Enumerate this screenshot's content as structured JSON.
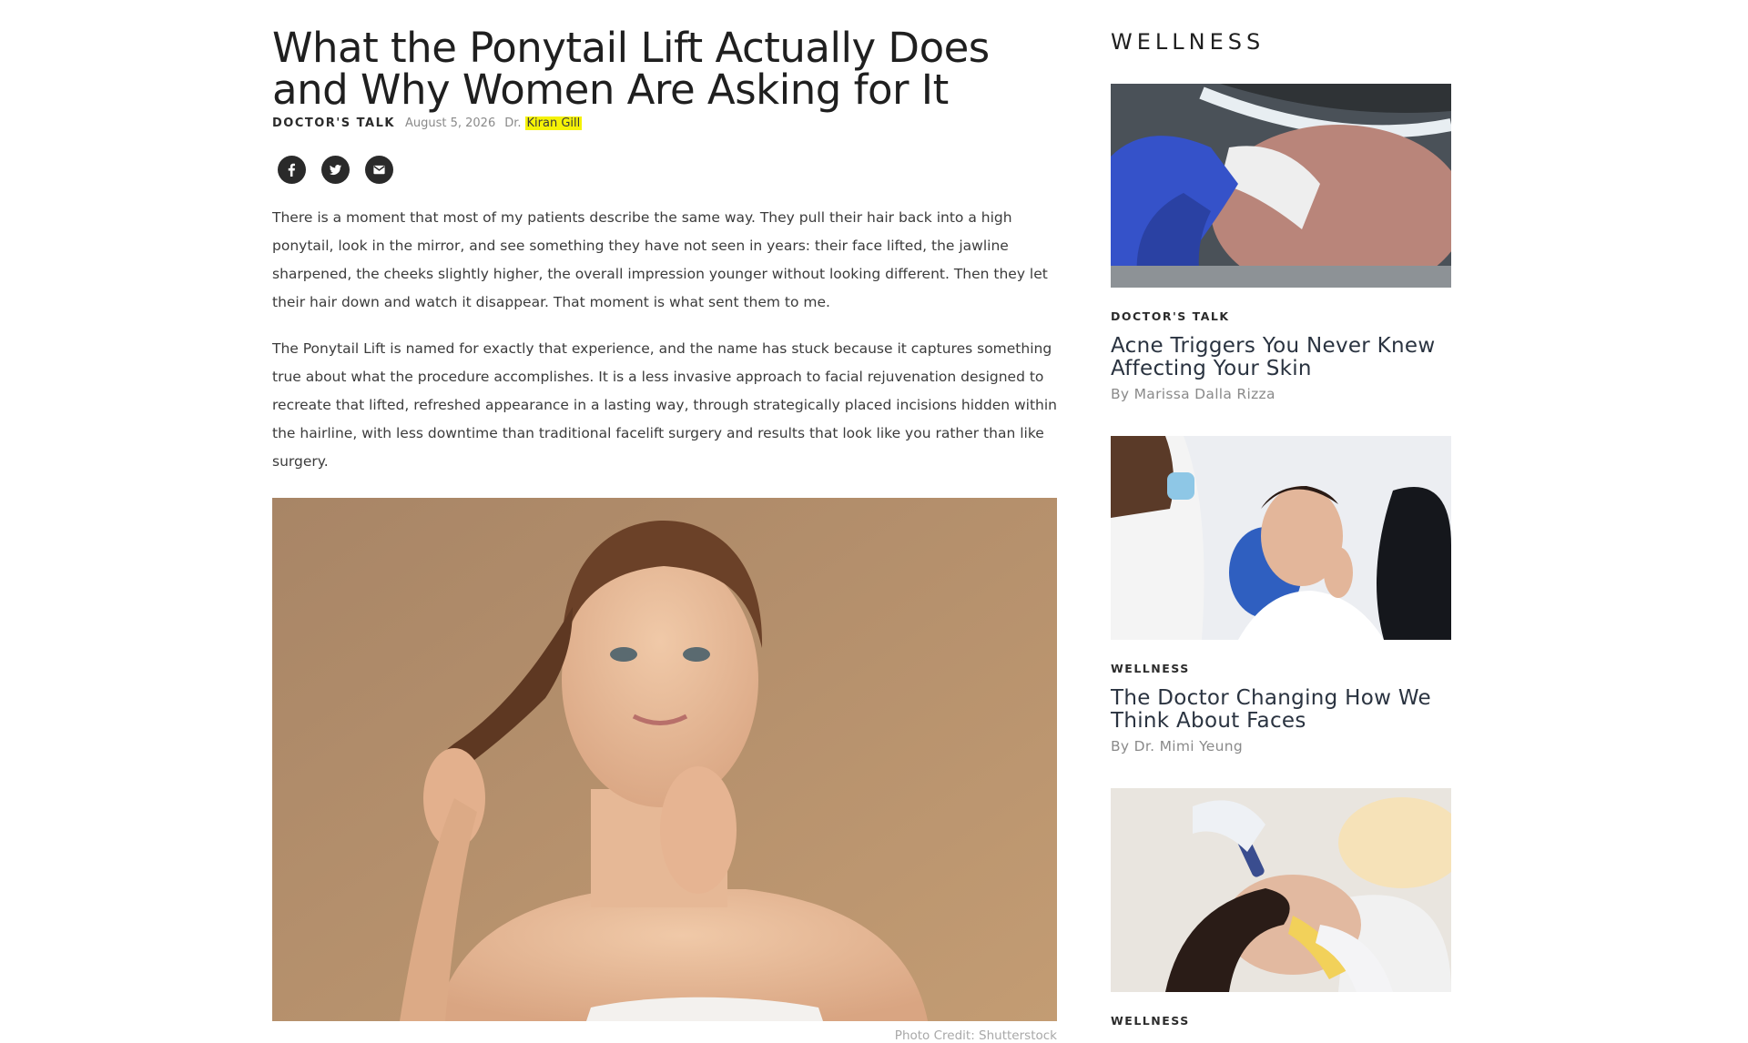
{
  "article": {
    "title": "What the Ponytail Lift Actually Does and Why Women Are Asking for It",
    "category": "DOCTOR'S TALK",
    "date": "August 5, 2026",
    "author_prefix": "Dr.",
    "author": "Kiran Gill",
    "share_icons": [
      "facebook-icon",
      "twitter-icon",
      "email-icon"
    ],
    "paragraphs": [
      "There is a moment that most of my patients describe the same way. They pull their hair back into a high ponytail, look in the mirror, and see something they have not seen in years: their face lifted, the jawline sharpened, the cheeks slightly higher, the overall impression younger without looking different. Then they let their hair down and watch it disappear. That moment is what sent them to me.",
      "The Ponytail Lift is named for exactly that experience, and the name has stuck because it captures something true about what the procedure accomplishes. It is a less invasive approach to facial rejuvenation designed to recreate that lifted, refreshed appearance in a lasting way, through strategically placed incisions hidden within the hairline, with less downtime than traditional facelift surgery and results that look like you rather than like surgery."
    ],
    "photo_credit": "Photo Credit: Shutterstock"
  },
  "sidebar": {
    "heading": "WELLNESS",
    "cards": [
      {
        "category": "DOCTOR'S TALK",
        "title": "Acne Triggers You Never Knew Affecting Your Skin",
        "author": "By Marissa Dalla Rizza"
      },
      {
        "category": "WELLNESS",
        "title": "The Doctor Changing How We Think About Faces",
        "author": "By Dr. Mimi Yeung"
      },
      {
        "category": "WELLNESS"
      }
    ]
  },
  "colors": {
    "author_highlight": "#f5f207",
    "hero_background": "#b38f6c",
    "text_dark": "#1f1f1f"
  }
}
